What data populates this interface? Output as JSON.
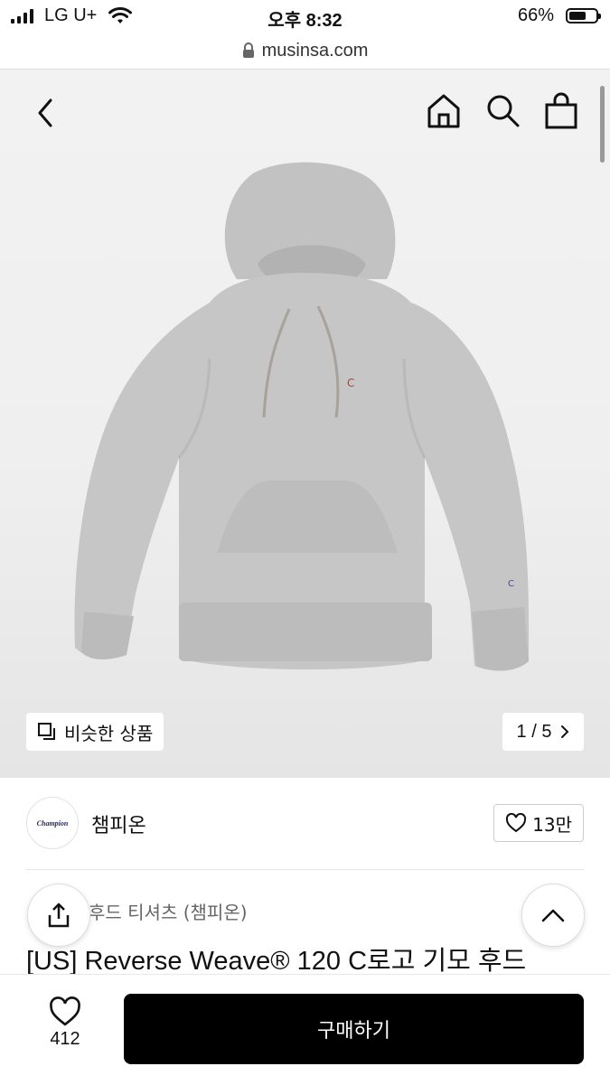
{
  "status_bar": {
    "carrier": "LG U+",
    "time": "오후 8:32",
    "battery_percent_label": "66%",
    "battery_level": 0.66
  },
  "browser": {
    "url": "musinsa.com"
  },
  "top_nav": {
    "back_icon": "chevron-left-icon",
    "home_icon": "home-icon",
    "search_icon": "search-icon",
    "cart_icon": "shopping-bag-icon"
  },
  "gallery": {
    "similar_label": "비슷한 상품",
    "page_indicator": "1 / 5",
    "product_color": "#c9c9c9"
  },
  "brand": {
    "logo_text": "Champion",
    "name": "챔피온",
    "likes": "13만"
  },
  "product": {
    "category": "후드 티셔츠 (챔피온)",
    "title": "[US] Reverse Weave® 120 C로고 기모 후드"
  },
  "bottom_bar": {
    "wish_count": "412",
    "buy_label": "구매하기"
  },
  "colors": {
    "buy_button": "#000000",
    "background": "#ffffff"
  }
}
